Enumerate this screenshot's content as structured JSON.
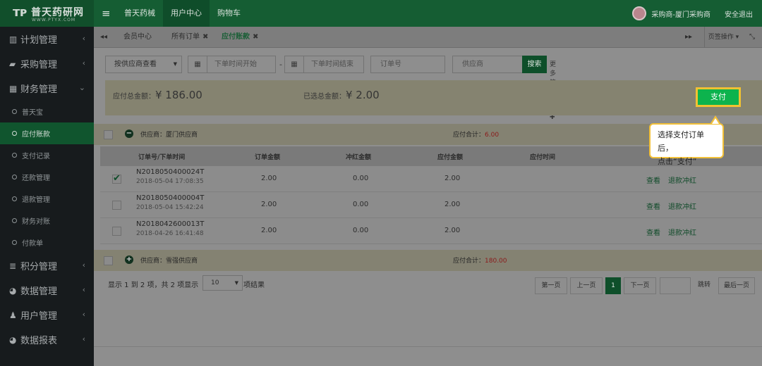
{
  "brand": {
    "name": "普天药研网",
    "sub": "WWW.PTYX.COM"
  },
  "topnav": [
    "普天药械",
    "用户中心",
    "购物车"
  ],
  "user": {
    "name": "采购商-厦门采购商",
    "logout": "安全退出"
  },
  "sidebar": {
    "items": [
      {
        "icon": "chart-icon",
        "label": "计划管理"
      },
      {
        "icon": "cart-icon",
        "label": "采购管理"
      },
      {
        "icon": "calculator-icon",
        "label": "财务管理"
      },
      {
        "icon": "database-icon",
        "label": "积分管理"
      },
      {
        "icon": "pie-chart-icon",
        "label": "数据管理"
      },
      {
        "icon": "user-icon",
        "label": "用户管理"
      },
      {
        "icon": "pie-chart-icon",
        "label": "数据报表"
      }
    ],
    "sub_items": [
      "普天宝",
      "应付账款",
      "支付记录",
      "还款管理",
      "退款管理",
      "财务对账",
      "付款单"
    ],
    "active_sub": "应付账款"
  },
  "tabs": [
    "会员中心",
    "所有订单",
    "应付账款"
  ],
  "tab_bar": {
    "page_ops": "页签操作"
  },
  "filters": {
    "view_by": "按供应商查看",
    "start_placeholder": "下单时间开始",
    "end_placeholder": "下单时间结束",
    "order_placeholder": "订单号",
    "supplier_placeholder": "供应商",
    "search_label": "搜索",
    "more_label": "更多筛选条件"
  },
  "summary": {
    "total_label": "应付总金额：",
    "total_value": "¥ 186.00",
    "selected_label": "已选总金额：",
    "selected_value": "¥ 2.00"
  },
  "pay_label": "支付",
  "callout": {
    "line1": "选择支付订单后，",
    "line2": "点击“支付”"
  },
  "groups": [
    {
      "supplier": "供应商：厦门供应商",
      "total_label": "应付合计：",
      "total_value": "6.00"
    },
    {
      "supplier": "供应商：雪强供应商",
      "total_label": "应付合计：",
      "total_value": "180.00"
    }
  ],
  "columns": [
    "订单号/下单时间",
    "订单金额",
    "冲红金额",
    "应付金额",
    "应付时间"
  ],
  "rows": [
    {
      "no": "N2018050400024T",
      "time": "2018-05-04 17:08:35",
      "amount": "2.00",
      "red": "0.00",
      "payable": "2.00",
      "checked": true
    },
    {
      "no": "N2018050400004T",
      "time": "2018-05-04 15:42:24",
      "amount": "2.00",
      "red": "0.00",
      "payable": "2.00",
      "checked": false
    },
    {
      "no": "N2018042600013T",
      "time": "2018-04-26 16:41:48",
      "amount": "2.00",
      "red": "0.00",
      "payable": "2.00",
      "checked": false
    }
  ],
  "row_actions": {
    "view": "查看",
    "refund": "退款冲红"
  },
  "pager": {
    "info": "显示 1 到 2 项，共 2 项显示",
    "page_size": "10",
    "after": "项结果",
    "first": "第一页",
    "prev": "上一页",
    "current": "1",
    "next": "下一页",
    "jump": "跳转",
    "last": "最后一页"
  }
}
